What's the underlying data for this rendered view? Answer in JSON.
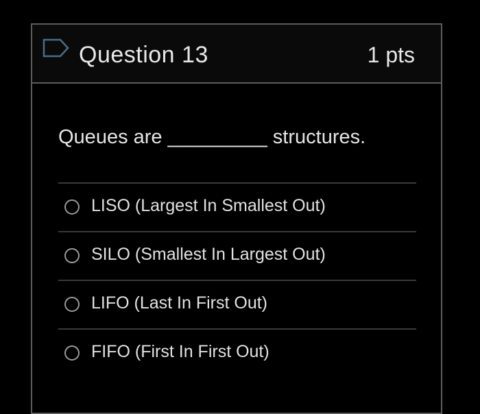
{
  "question": {
    "title": "Question 13",
    "points": "1 pts",
    "text": "Queues are _________ structures.",
    "flag_icon": "bookmark-flag-icon"
  },
  "answers": [
    {
      "label": "LISO (Largest In Smallest Out)",
      "selected": false
    },
    {
      "label": "SILO (Smallest In Largest Out)",
      "selected": false
    },
    {
      "label": "LIFO (Last In First Out)",
      "selected": false
    },
    {
      "label": "FIFO (First In First Out)",
      "selected": false
    }
  ],
  "colors": {
    "background": "#000000",
    "border": "#5c5c5c",
    "text": "#e6e6e6",
    "flag": "#4a6d8c"
  }
}
